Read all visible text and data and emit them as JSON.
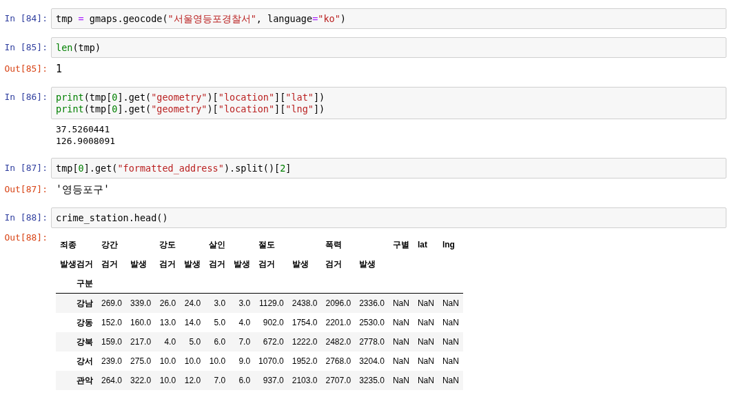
{
  "cells": [
    {
      "prompt": "In [84]:",
      "code": [
        [
          {
            "kind": "plain",
            "text": "tmp "
          },
          {
            "kind": "op",
            "text": "="
          },
          {
            "kind": "plain",
            "text": " gmaps.geocode("
          },
          {
            "kind": "string",
            "text": "\"서울영등포경찰서\""
          },
          {
            "kind": "plain",
            "text": ", language"
          },
          {
            "kind": "op",
            "text": "="
          },
          {
            "kind": "string",
            "text": "\"ko\""
          },
          {
            "kind": "plain",
            "text": ")"
          }
        ]
      ]
    },
    {
      "prompt": "In [85]:",
      "code": [
        [
          {
            "kind": "builtin",
            "text": "len"
          },
          {
            "kind": "plain",
            "text": "(tmp)"
          }
        ]
      ],
      "outputs": [
        {
          "kind": "result",
          "prompt": "Out[85]:",
          "lines": [
            "1"
          ]
        }
      ]
    },
    {
      "prompt": "In [86]:",
      "code": [
        [
          {
            "kind": "builtin",
            "text": "print"
          },
          {
            "kind": "plain",
            "text": "(tmp["
          },
          {
            "kind": "number",
            "text": "0"
          },
          {
            "kind": "plain",
            "text": "].get("
          },
          {
            "kind": "string",
            "text": "\"geometry\""
          },
          {
            "kind": "plain",
            "text": ")["
          },
          {
            "kind": "string",
            "text": "\"location\""
          },
          {
            "kind": "plain",
            "text": "]["
          },
          {
            "kind": "string",
            "text": "\"lat\""
          },
          {
            "kind": "plain",
            "text": "])"
          }
        ],
        [
          {
            "kind": "builtin",
            "text": "print"
          },
          {
            "kind": "plain",
            "text": "(tmp["
          },
          {
            "kind": "number",
            "text": "0"
          },
          {
            "kind": "plain",
            "text": "].get("
          },
          {
            "kind": "string",
            "text": "\"geometry\""
          },
          {
            "kind": "plain",
            "text": ")["
          },
          {
            "kind": "string",
            "text": "\"location\""
          },
          {
            "kind": "plain",
            "text": "]["
          },
          {
            "kind": "string",
            "text": "\"lng\""
          },
          {
            "kind": "plain",
            "text": "])"
          }
        ]
      ],
      "outputs": [
        {
          "kind": "stream",
          "lines": [
            "37.5260441",
            "126.9008091"
          ]
        }
      ]
    },
    {
      "prompt": "In [87]:",
      "code": [
        [
          {
            "kind": "plain",
            "text": "tmp["
          },
          {
            "kind": "number",
            "text": "0"
          },
          {
            "kind": "plain",
            "text": "].get("
          },
          {
            "kind": "string",
            "text": "\"formatted_address\""
          },
          {
            "kind": "plain",
            "text": ").split()["
          },
          {
            "kind": "number",
            "text": "2"
          },
          {
            "kind": "plain",
            "text": "]"
          }
        ]
      ],
      "outputs": [
        {
          "kind": "result",
          "prompt": "Out[87]:",
          "lines": [
            "'영등포구'"
          ]
        }
      ]
    },
    {
      "prompt": "In [88]:",
      "code": [
        [
          {
            "kind": "plain",
            "text": "crime_station.head()"
          }
        ]
      ],
      "outputs": [
        {
          "kind": "table",
          "prompt": "Out[88]:",
          "header_rows": [
            [
              {
                "text": "죄종",
                "kind": "leaf"
              },
              {
                "text": "강간",
                "kind": "group"
              },
              {
                "text": "강도",
                "kind": "group"
              },
              {
                "text": "살인",
                "kind": "group"
              },
              {
                "text": "절도",
                "kind": "group"
              },
              {
                "text": "폭력",
                "kind": "group"
              },
              {
                "text": "구별",
                "kind": "leaf"
              },
              {
                "text": "lat",
                "kind": "leaf"
              },
              {
                "text": "lng",
                "kind": "leaf"
              }
            ],
            [
              {
                "text": "발생검거",
                "kind": "leaf"
              },
              {
                "text": "검거",
                "kind": "leaf"
              },
              {
                "text": "발생",
                "kind": "leaf"
              },
              {
                "text": "검거",
                "kind": "leaf"
              },
              {
                "text": "발생",
                "kind": "leaf"
              },
              {
                "text": "검거",
                "kind": "leaf"
              },
              {
                "text": "발생",
                "kind": "leaf"
              },
              {
                "text": "검거",
                "kind": "leaf"
              },
              {
                "text": "발생",
                "kind": "leaf"
              },
              {
                "text": "검거",
                "kind": "leaf"
              },
              {
                "text": "발생",
                "kind": "leaf"
              }
            ],
            [
              {
                "text": "구분",
                "kind": "leaf"
              }
            ]
          ],
          "rows": [
            {
              "index": "강남",
              "values": [
                "269.0",
                "339.0",
                "26.0",
                "24.0",
                "3.0",
                "3.0",
                "1129.0",
                "2438.0",
                "2096.0",
                "2336.0",
                "NaN",
                "NaN",
                "NaN"
              ]
            },
            {
              "index": "강동",
              "values": [
                "152.0",
                "160.0",
                "13.0",
                "14.0",
                "5.0",
                "4.0",
                "902.0",
                "1754.0",
                "2201.0",
                "2530.0",
                "NaN",
                "NaN",
                "NaN"
              ]
            },
            {
              "index": "강북",
              "values": [
                "159.0",
                "217.0",
                "4.0",
                "5.0",
                "6.0",
                "7.0",
                "672.0",
                "1222.0",
                "2482.0",
                "2778.0",
                "NaN",
                "NaN",
                "NaN"
              ]
            },
            {
              "index": "강서",
              "values": [
                "239.0",
                "275.0",
                "10.0",
                "10.0",
                "10.0",
                "9.0",
                "1070.0",
                "1952.0",
                "2768.0",
                "3204.0",
                "NaN",
                "NaN",
                "NaN"
              ]
            },
            {
              "index": "관악",
              "values": [
                "264.0",
                "322.0",
                "10.0",
                "12.0",
                "7.0",
                "6.0",
                "937.0",
                "2103.0",
                "2707.0",
                "3235.0",
                "NaN",
                "NaN",
                "NaN"
              ]
            }
          ]
        }
      ]
    }
  ]
}
